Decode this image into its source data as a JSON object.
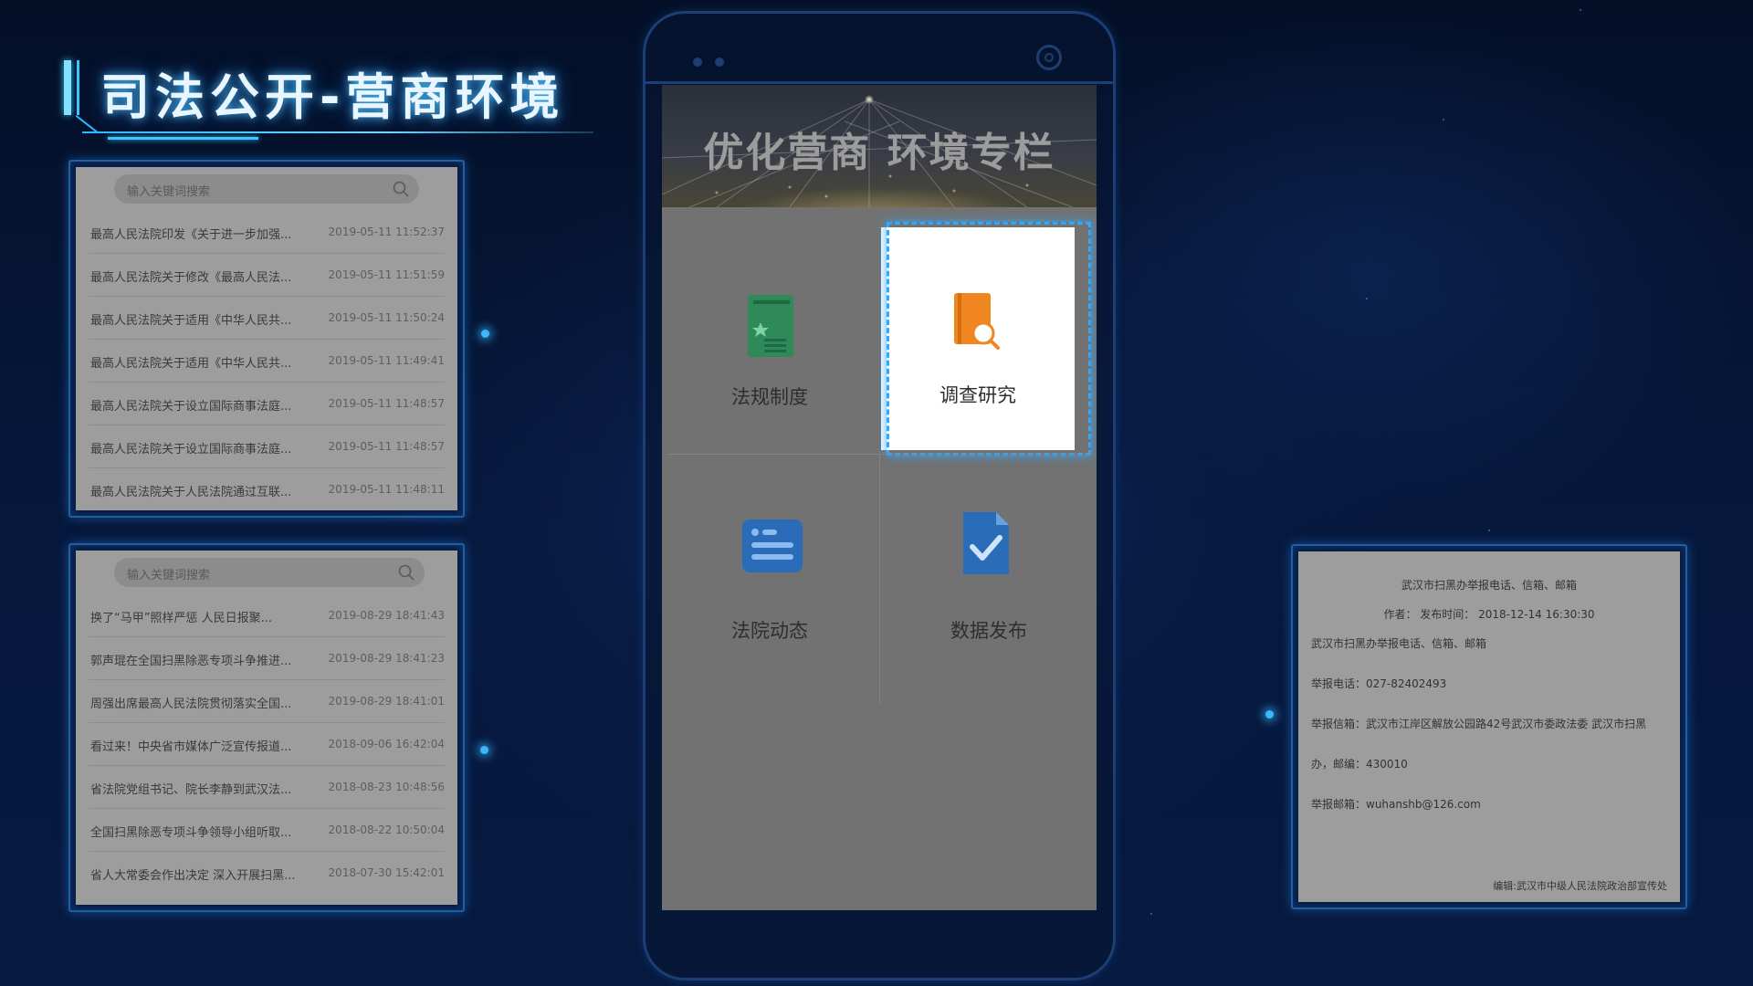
{
  "page": {
    "title": "司法公开-营商环境"
  },
  "colors": {
    "accent": "#38c6ff",
    "panel_border": "#1f5fa3",
    "icon_green": "#2f8a5a",
    "icon_orange": "#f0861f",
    "icon_blue": "#2a6cb8"
  },
  "list1": {
    "search_placeholder": "输入关键词搜索",
    "items": [
      {
        "title": "最高人民法院印发《关于进一步加强...",
        "time": "2019-05-11 11:52:37"
      },
      {
        "title": "最高人民法院关于修改《最高人民法...",
        "time": "2019-05-11 11:51:59"
      },
      {
        "title": "最高人民法院关于适用《中华人民共...",
        "time": "2019-05-11 11:50:24"
      },
      {
        "title": "最高人民法院关于适用《中华人民共...",
        "time": "2019-05-11 11:49:41"
      },
      {
        "title": "最高人民法院关于设立国际商事法庭...",
        "time": "2019-05-11 11:48:57"
      },
      {
        "title": "最高人民法院关于设立国际商事法庭...",
        "time": "2019-05-11 11:48:57"
      },
      {
        "title": "最高人民法院关于人民法院通过互联...",
        "time": "2019-05-11 11:48:11"
      }
    ]
  },
  "list2": {
    "search_placeholder": "输入关键词搜索",
    "items": [
      {
        "title": "换了“马甲”照样严惩 人民日报聚...",
        "time": "2019-08-29 18:41:43"
      },
      {
        "title": "郭声琨在全国扫黑除恶专项斗争推进...",
        "time": "2019-08-29 18:41:23"
      },
      {
        "title": "周强出席最高人民法院贯彻落实全国...",
        "time": "2019-08-29 18:41:01"
      },
      {
        "title": "看过来！中央省市媒体广泛宣传报道...",
        "time": "2018-09-06 16:42:04"
      },
      {
        "title": "省法院党组书记、院长李静到武汉法...",
        "time": "2018-08-23 10:48:56"
      },
      {
        "title": "全国扫黑除恶专项斗争领导小组听取...",
        "time": "2018-08-22 10:50:04"
      },
      {
        "title": "省人大常委会作出决定 深入开展扫黑...",
        "time": "2018-07-30 15:42:01"
      }
    ]
  },
  "phone": {
    "banner_text": "优化营商 环境专栏",
    "tiles": [
      {
        "label": "法规制度",
        "icon": "law-book-icon"
      },
      {
        "label": "调查研究",
        "icon": "book-search-icon"
      },
      {
        "label": "法院动态",
        "icon": "news-card-icon"
      },
      {
        "label": "数据发布",
        "icon": "document-check-icon"
      }
    ],
    "selected_tile": "调查研究"
  },
  "article": {
    "title": "武汉市扫黑办举报电话、信箱、邮箱",
    "meta": "作者： 发布时间： 2018-12-14 16:30:30",
    "lines": [
      "武汉市扫黑办举报电话、信箱、邮箱",
      "举报电话：027-82402493",
      "举报信箱：武汉市江岸区解放公园路42号武汉市委政法委 武汉市扫黑",
      "办，邮编：430010",
      "举报邮箱：wuhanshb@126.com"
    ],
    "editor": "编辑:武汉市中级人民法院政治部宣传处"
  }
}
